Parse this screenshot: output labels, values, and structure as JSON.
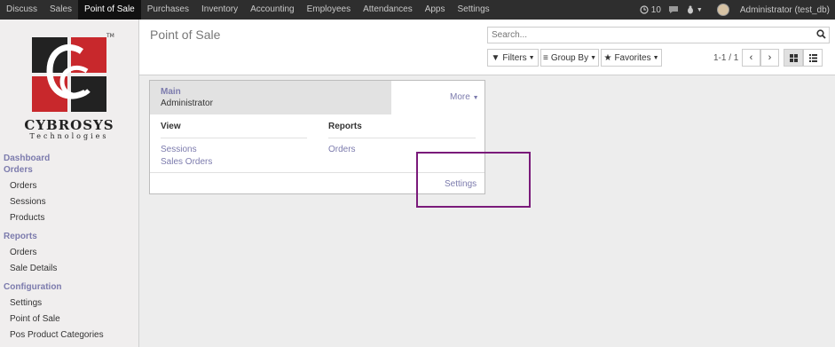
{
  "topnav": {
    "items": [
      "Discuss",
      "Sales",
      "Point of Sale",
      "Purchases",
      "Inventory",
      "Accounting",
      "Employees",
      "Attendances",
      "Apps",
      "Settings"
    ],
    "active_index": 2,
    "messages_count": "10",
    "user": "Administrator (test_db)"
  },
  "sidebar": {
    "brand": "CYBROSYS",
    "brand_sub": "Technologies",
    "sections": [
      {
        "label": "Dashboard",
        "items": []
      },
      {
        "label": "Orders",
        "items": [
          "Orders",
          "Sessions",
          "Products"
        ]
      },
      {
        "label": "Reports",
        "items": [
          "Orders",
          "Sale Details"
        ]
      },
      {
        "label": "Configuration",
        "items": [
          "Settings",
          "Point of Sale",
          "Pos Product Categories"
        ]
      }
    ]
  },
  "control_panel": {
    "title": "Point of Sale",
    "search_placeholder": "Search...",
    "filters_label": "Filters",
    "group_by_label": "Group By",
    "favorites_label": "Favorites",
    "pager": "1-1 / 1"
  },
  "card": {
    "name": "Main",
    "user": "Administrator",
    "more_label": "More",
    "view_header": "View",
    "reports_header": "Reports",
    "view_links": [
      "Sessions",
      "Sales Orders"
    ],
    "report_links": [
      "Orders"
    ],
    "settings_label": "Settings"
  },
  "colors": {
    "topbar": "#2e2e2e",
    "accent": "#7c7bad",
    "highlight_box": "#7a1a7a",
    "logo_red": "#c8282c",
    "logo_black": "#222222"
  }
}
